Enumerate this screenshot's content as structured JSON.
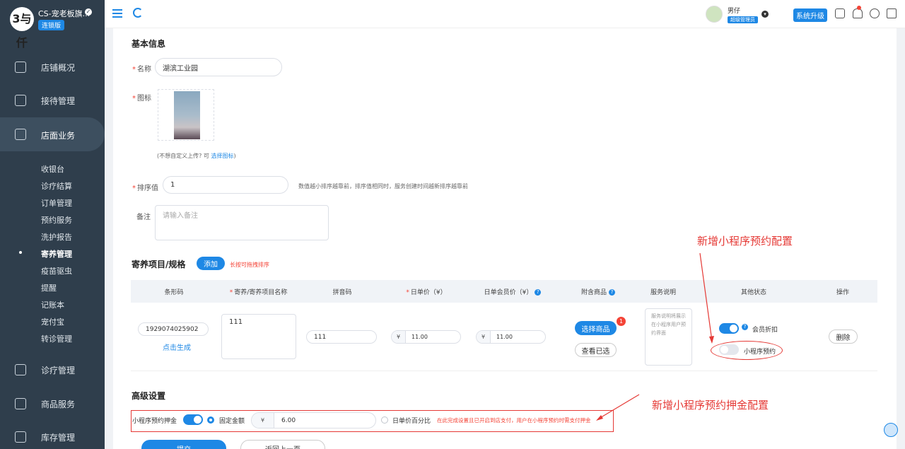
{
  "brand": {
    "logo_text": "3与仟",
    "name": "CS-宠老板旗...",
    "edition": "连锁版"
  },
  "header": {
    "user_name": "男仔",
    "user_role": "超级管理员",
    "upgrade": "系统升级"
  },
  "nav": {
    "items": [
      "店铺概况",
      "接待管理",
      "店面业务",
      "诊疗管理",
      "商品服务",
      "库存管理"
    ],
    "sub_items": [
      "收银台",
      "诊疗结算",
      "订单管理",
      "预约服务",
      "洗护报告",
      "寄养管理",
      "疫苗驱虫",
      "提醒",
      "记账本",
      "宠付宝",
      "转诊管理"
    ]
  },
  "basic": {
    "title": "基本信息",
    "name_label": "名称",
    "name_value": "湖滨工业园",
    "icon_label": "图标",
    "icon_hint": "(不想自定义上传? 可",
    "icon_link": "选择图标",
    "icon_hint_end": ")",
    "sort_label": "排序值",
    "sort_value": "1",
    "sort_hint": "数值越小排序越靠前，排序值相同时，服务创建时间越新排序越靠前",
    "remark_label": "备注",
    "remark_placeholder": "请输入备注"
  },
  "items": {
    "title": "寄养项目/规格",
    "add": "添加",
    "drag_hint": "长按可拖拽排序",
    "headers": [
      "条形码",
      "寄养/寄养项目名称",
      "拼音码",
      "日单价（¥）",
      "日单会员价（¥）",
      "附含商品",
      "服务说明",
      "其他状态",
      "操作"
    ],
    "row": {
      "barcode": "1929074025902",
      "generate": "点击生成",
      "name": "111",
      "pinyin": "111",
      "currency": "¥",
      "price": "11.00",
      "member_price": "11.00",
      "select_goods": "选择商品",
      "goods_count": "1",
      "view_selected": "查看已选",
      "service_desc": "服务说明将展示在小程序用户预约界面",
      "member_discount": "会员折扣",
      "mini_booking": "小程序预约",
      "delete": "删除"
    }
  },
  "advanced": {
    "title": "高级设置",
    "deposit_label": "小程序预约押金",
    "fixed_amount": "固定金额",
    "currency": "¥",
    "amount": "6.00",
    "percent": "日单价百分比",
    "note": "在此完成设置且已开启到店支付，用户在小程序预约时需支付押金"
  },
  "buttons": {
    "submit": "提交",
    "back": "返回上一页"
  },
  "annotations": {
    "a1": "新增小程序预约配置",
    "a2": "新增小程序预约押金配置"
  },
  "colors": {
    "primary": "#1e88e5",
    "sidebar": "#2f3e4c",
    "annotation": "#e53935"
  }
}
